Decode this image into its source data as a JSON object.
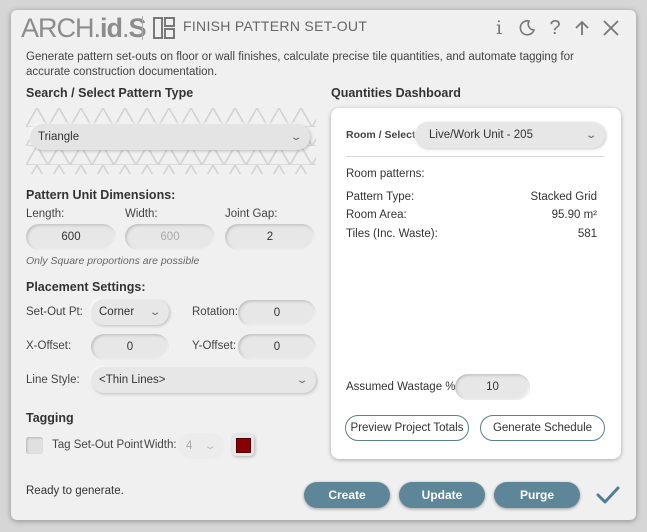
{
  "header": {
    "logo_arch": "ARCH",
    "logo_dot": ".",
    "logo_id": "id",
    "logo_s": "S",
    "title": "FINISH PATTERN SET-OUT",
    "info_glyph": "i",
    "help_glyph": "?"
  },
  "description": "Generate pattern set-outs on floor or wall finishes, calculate precise tile quantities, and automate tagging for accurate construction documentation.",
  "pattern": {
    "section_label": "Search / Select Pattern Type",
    "selected": "Triangle"
  },
  "dimensions": {
    "section_label": "Pattern Unit Dimensions:",
    "length_label": "Length:",
    "length_value": "600",
    "width_label": "Width:",
    "width_value": "600",
    "gap_label": "Joint Gap:",
    "gap_value": "2",
    "note": "Only Square proportions are possible"
  },
  "placement": {
    "section_label": "Placement Settings:",
    "setout_label": "Set-Out Pt:",
    "setout_value": "Corner",
    "rotation_label": "Rotation:",
    "rotation_value": "0",
    "xoffset_label": "X-Offset:",
    "xoffset_value": "0",
    "yoffset_label": "Y-Offset:",
    "yoffset_value": "0",
    "linestyle_label": "Line Style:",
    "linestyle_value": "<Thin Lines>"
  },
  "tagging": {
    "section_label": "Tagging",
    "checkbox_label": "Tag Set-Out Point",
    "width_label": "Width:",
    "width_value": "4",
    "swatch_color": "#8b0000"
  },
  "dashboard": {
    "section_label": "Quantities Dashboard",
    "room_label": "Room / Select",
    "room_value": "Live/Work Unit - 205",
    "room_patterns_label": "Room patterns:",
    "rows": [
      {
        "label": "Pattern Type:",
        "value": "Stacked Grid"
      },
      {
        "label": "Room Area:",
        "value": "95.90 m²"
      },
      {
        "label": "Tiles (Inc. Waste):",
        "value": "581"
      }
    ],
    "wastage_label": "Assumed Wastage %:",
    "wastage_value": "10",
    "preview_button": "Preview Project Totals",
    "schedule_button": "Generate Schedule"
  },
  "footer": {
    "status": "Ready to generate.",
    "create": "Create",
    "update": "Update",
    "purge": "Purge"
  },
  "colors": {
    "accent": "#5e8699",
    "outline": "#5a7f94",
    "check": "#4f7f97"
  }
}
